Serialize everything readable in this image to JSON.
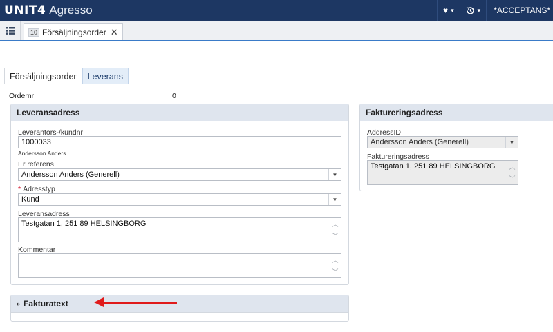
{
  "app": {
    "brand_unit4": "UNIT4",
    "brand_agresso": "Agresso",
    "user_label": "*ACCEPTANS*"
  },
  "tabs": {
    "doc_number": "10",
    "doc_title": "Försäljningsorder",
    "close_glyph": "✕"
  },
  "subtabs": [
    {
      "label": "Försäljningsorder",
      "active": false
    },
    {
      "label": "Leverans",
      "active": true
    }
  ],
  "order": {
    "ordernr_label": "Ordernr",
    "ordernr_value": "0"
  },
  "delivery": {
    "title": "Leveransadress",
    "supplier_label": "Leverantörs-/kundnr",
    "supplier_value": "1000033",
    "supplier_hint": "Andersson Anders",
    "reference_label": "Er referens",
    "reference_value": "Andersson Anders (Generell)",
    "addresstype_required": "*",
    "addresstype_label": "Adresstyp",
    "addresstype_value": "Kund",
    "address_label": "Leveransadress",
    "address_value": "Testgatan 1, 251 89 HELSINGBORG",
    "comment_label": "Kommentar",
    "comment_value": ""
  },
  "invoice": {
    "title": "Faktureringsadress",
    "addressid_label": "AddressID",
    "addressid_value": "Andersson Anders (Generell)",
    "address_label": "Faktureringsadress",
    "address_value": "Testgatan 1, 251 89 HELSINGBORG"
  },
  "invoicetext": {
    "title": "Fakturatext",
    "expand_glyph": "»"
  },
  "colors": {
    "topbar": "#1d3763",
    "accent": "#3a7bc8",
    "annotation_arrow": "#e01b1b"
  }
}
